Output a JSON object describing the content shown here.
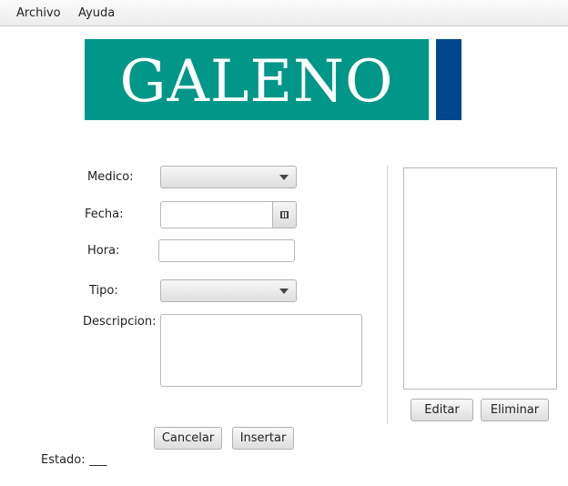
{
  "menu": {
    "archivo": "Archivo",
    "ayuda": "Ayuda"
  },
  "logo": {
    "text": "GALENO"
  },
  "form": {
    "medico_label": "Medico:",
    "fecha_label": "Fecha:",
    "hora_label": "Hora:",
    "tipo_label": "Tipo:",
    "descripcion_label": "Descripcion:",
    "medico_value": "",
    "fecha_value": "",
    "hora_value": "",
    "tipo_value": "",
    "descripcion_value": ""
  },
  "actions": {
    "cancelar": "Cancelar",
    "insertar": "Insertar",
    "editar": "Editar",
    "eliminar": "Eliminar"
  },
  "status": {
    "label": "Estado:",
    "value": "___"
  },
  "colors": {
    "logo_bg": "#009688",
    "logo_bar": "#00468b"
  }
}
